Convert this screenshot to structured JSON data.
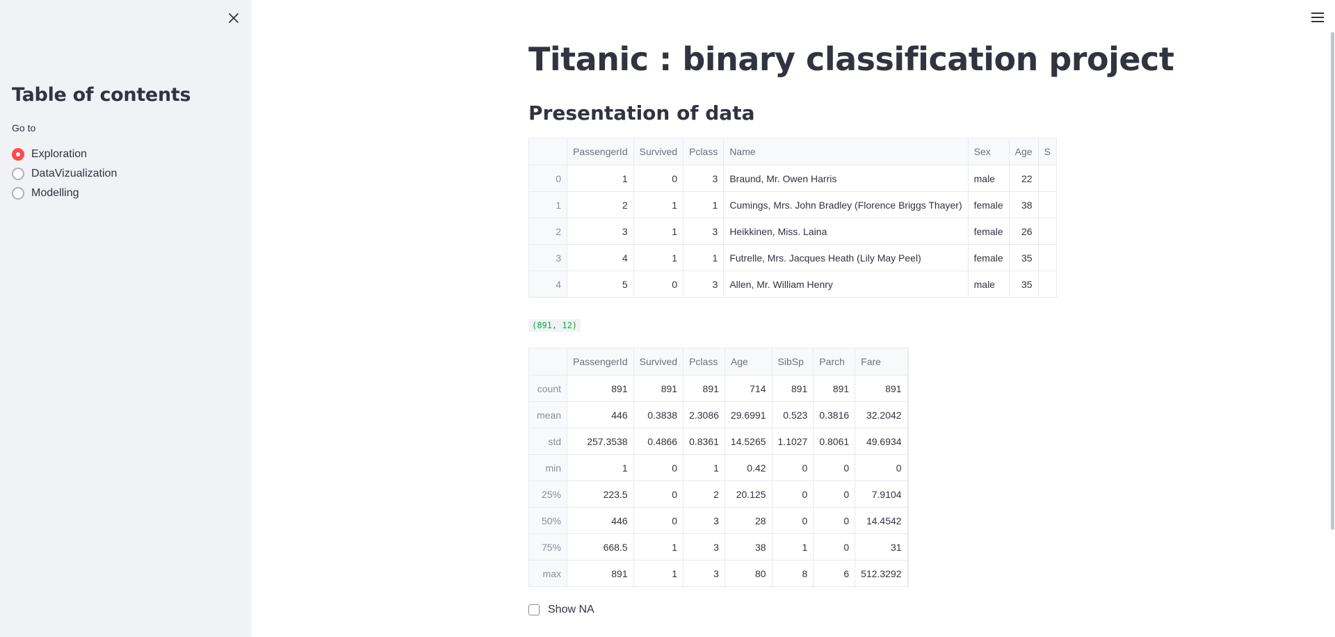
{
  "sidebar": {
    "title": "Table of contents",
    "goto_label": "Go to",
    "options": [
      {
        "label": "Exploration",
        "selected": true
      },
      {
        "label": "DataVizualization",
        "selected": false
      },
      {
        "label": "Modelling",
        "selected": false
      }
    ]
  },
  "main": {
    "title": "Titanic : binary classification project",
    "section": "Presentation of data",
    "head_table": {
      "columns": [
        "",
        "PassengerId",
        "Survived",
        "Pclass",
        "Name",
        "Sex",
        "Age",
        "S"
      ],
      "rows": [
        [
          "0",
          "1",
          "0",
          "3",
          "Braund, Mr. Owen Harris",
          "male",
          "22",
          ""
        ],
        [
          "1",
          "2",
          "1",
          "1",
          "Cumings, Mrs. John Bradley (Florence Briggs Thayer)",
          "female",
          "38",
          ""
        ],
        [
          "2",
          "3",
          "1",
          "3",
          "Heikkinen, Miss. Laina",
          "female",
          "26",
          ""
        ],
        [
          "3",
          "4",
          "1",
          "1",
          "Futrelle, Mrs. Jacques Heath (Lily May Peel)",
          "female",
          "35",
          ""
        ],
        [
          "4",
          "5",
          "0",
          "3",
          "Allen, Mr. William Henry",
          "male",
          "35",
          ""
        ]
      ]
    },
    "shape": "(891, 12)",
    "describe_table": {
      "columns": [
        "",
        "PassengerId",
        "Survived",
        "Pclass",
        "Age",
        "SibSp",
        "Parch",
        "Fare"
      ],
      "rows": [
        [
          "count",
          "891",
          "891",
          "891",
          "714",
          "891",
          "891",
          "891"
        ],
        [
          "mean",
          "446",
          "0.3838",
          "2.3086",
          "29.6991",
          "0.523",
          "0.3816",
          "32.2042"
        ],
        [
          "std",
          "257.3538",
          "0.4866",
          "0.8361",
          "14.5265",
          "1.1027",
          "0.8061",
          "49.6934"
        ],
        [
          "min",
          "1",
          "0",
          "1",
          "0.42",
          "0",
          "0",
          "0"
        ],
        [
          "25%",
          "223.5",
          "0",
          "2",
          "20.125",
          "0",
          "0",
          "7.9104"
        ],
        [
          "50%",
          "446",
          "0",
          "3",
          "28",
          "0",
          "0",
          "14.4542"
        ],
        [
          "75%",
          "668.5",
          "1",
          "3",
          "38",
          "1",
          "0",
          "31"
        ],
        [
          "max",
          "891",
          "1",
          "3",
          "80",
          "8",
          "6",
          "512.3292"
        ]
      ]
    },
    "show_na_label": "Show NA"
  },
  "colors": {
    "accent": "#ff4b4b",
    "sidebar_bg": "#f0f2f6",
    "text": "#31333f",
    "code_green": "#09ab3b"
  },
  "icons": {
    "close": "close-icon",
    "menu": "hamburger-menu-icon"
  }
}
